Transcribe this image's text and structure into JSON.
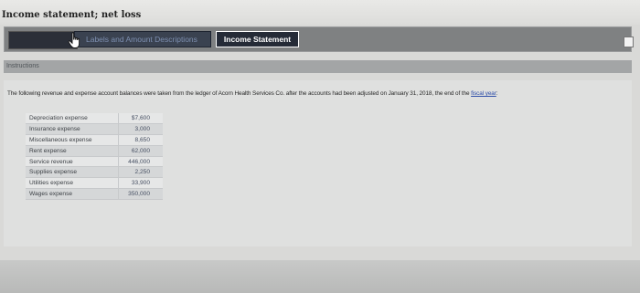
{
  "window": {
    "title": "Income statement; net loss"
  },
  "tabs": [
    {
      "label": ""
    },
    {
      "label": "Labels and Amount Descriptions"
    },
    {
      "label": "Income Statement"
    }
  ],
  "section": {
    "header": "Instructions"
  },
  "instructions": {
    "text_before_link": "The following revenue and expense account balances were taken from the ledger of Acorn Health Services Co. after the accounts had been adjusted on January 31, 2018, the end of the ",
    "link_text": "fiscal year",
    "text_after_link": ":"
  },
  "accounts": [
    {
      "name": "Depreciation expense",
      "amount": "$7,600"
    },
    {
      "name": "Insurance expense",
      "amount": "3,000"
    },
    {
      "name": "Miscellaneous expense",
      "amount": "8,650"
    },
    {
      "name": "Rent expense",
      "amount": "62,000"
    },
    {
      "name": "Service revenue",
      "amount": "446,000"
    },
    {
      "name": "Supplies expense",
      "amount": "2,250"
    },
    {
      "name": "Utilities expense",
      "amount": "33,900"
    },
    {
      "name": "Wages expense",
      "amount": "350,000"
    }
  ],
  "icons": {
    "cursor": "hand-pointer-icon",
    "close": "close-icon"
  },
  "colors": {
    "tab_bar": "#7f8182",
    "active_tab": "#3a4250",
    "link": "#2f4fa8"
  }
}
